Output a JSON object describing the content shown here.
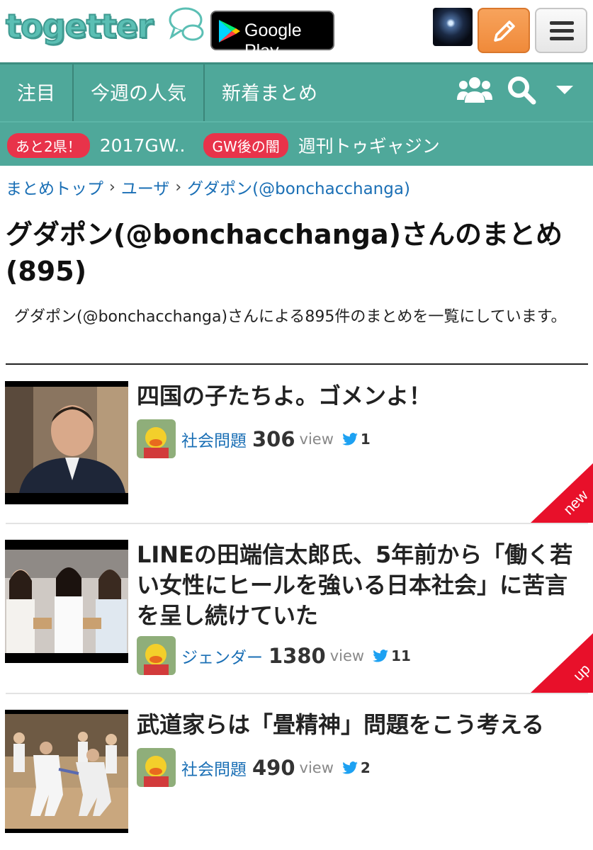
{
  "header": {
    "logo_text": "togetter",
    "store_badge": "Google Play"
  },
  "nav": {
    "tabs": [
      "注目",
      "今週の人気",
      "新着まとめ"
    ],
    "ticker": [
      {
        "badge": "あと2県！",
        "text": "2017GW.."
      },
      {
        "badge": "GW後の闇",
        "text": "週刊トゥギャジン"
      }
    ]
  },
  "breadcrumb": [
    "まとめトップ",
    "ユーザ",
    "グダポン(@bonchacchanga)"
  ],
  "page": {
    "title": "グダポン(@bonchacchanga)さんのまとめ(895)",
    "description": "グダポン(@bonchacchanga)さんによる895件のまとめを一覧にしています。"
  },
  "items": [
    {
      "title": "四国の子たちよ。ゴメンよ！",
      "category": "社会問題",
      "views": "306",
      "view_label": "view",
      "tweets": "1",
      "corner": "new"
    },
    {
      "title": "LINEの田端信太郎氏、5年前から「働く若い女性にヒールを強いる日本社会」に苦言を呈し続けていた",
      "category": "ジェンダー",
      "views": "1380",
      "view_label": "view",
      "tweets": "11",
      "corner": "up"
    },
    {
      "title": "武道家らは「畳精神」問題をこう考える",
      "category": "社会問題",
      "views": "490",
      "view_label": "view",
      "tweets": "2",
      "corner": ""
    }
  ],
  "colors": {
    "nav_bg": "#4fa89a",
    "badge_red": "#e8334a",
    "link_blue": "#1a6fb5",
    "corner_red": "#e8102a",
    "twitter_blue": "#1da1f2"
  },
  "icons": [
    "speech-bubble-icon",
    "google-play-icon",
    "pencil-icon",
    "hamburger-icon",
    "users-icon",
    "search-icon",
    "caret-down-icon",
    "twitter-bird-icon"
  ]
}
